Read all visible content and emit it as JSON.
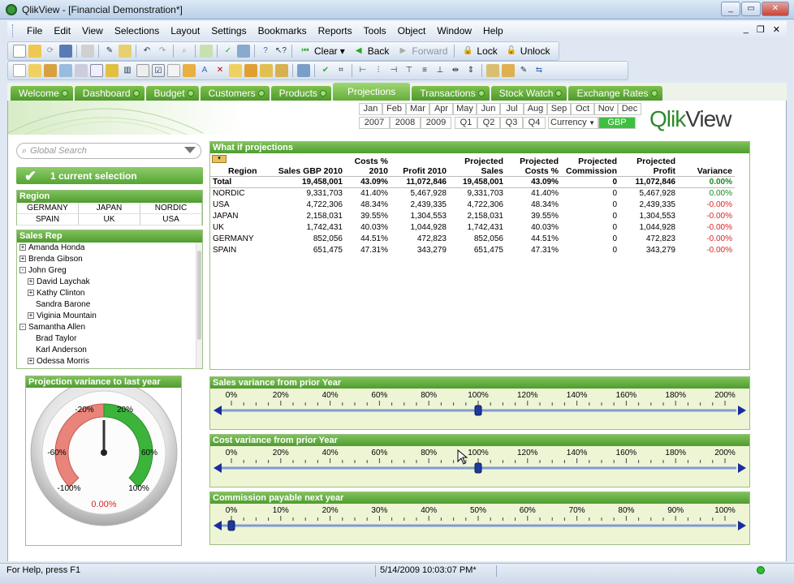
{
  "window": {
    "title": "QlikView - [Financial Demonstration*]"
  },
  "menu": [
    "File",
    "Edit",
    "View",
    "Selections",
    "Layout",
    "Settings",
    "Bookmarks",
    "Reports",
    "Tools",
    "Object",
    "Window",
    "Help"
  ],
  "toolbar": {
    "clear": "Clear",
    "back": "Back",
    "forward": "Forward",
    "lock": "Lock",
    "unlock": "Unlock"
  },
  "tabs": [
    {
      "label": "Welcome",
      "active": false
    },
    {
      "label": "Dashboard",
      "active": false
    },
    {
      "label": "Budget",
      "active": false
    },
    {
      "label": "Customers",
      "active": false
    },
    {
      "label": "Products",
      "active": false
    },
    {
      "label": "Projections",
      "active": true
    },
    {
      "label": "Transactions",
      "active": false
    },
    {
      "label": "Stock Watch",
      "active": false
    },
    {
      "label": "Exchange Rates",
      "active": false
    }
  ],
  "calendar": {
    "months": [
      "Jan",
      "Feb",
      "Mar",
      "Apr",
      "May",
      "Jun",
      "Jul",
      "Aug",
      "Sep",
      "Oct",
      "Nov",
      "Dec"
    ],
    "years": [
      "2007",
      "2008",
      "2009"
    ],
    "quarters": [
      "Q1",
      "Q2",
      "Q3",
      "Q4"
    ],
    "currency_label": "Currency",
    "currency_value": "GBP"
  },
  "logo": {
    "text": "QlikView"
  },
  "search": {
    "placeholder": "Global Search"
  },
  "current_selection": "1 current selection",
  "region": {
    "title": "Region",
    "items": [
      "GERMANY",
      "JAPAN",
      "NORDIC",
      "SPAIN",
      "UK",
      "USA"
    ]
  },
  "sales_rep": {
    "title": "Sales Rep",
    "items": [
      {
        "label": "Amanda Honda",
        "indent": 0,
        "toggle": "+"
      },
      {
        "label": "Brenda Gibson",
        "indent": 0,
        "toggle": "+"
      },
      {
        "label": "John Greg",
        "indent": 0,
        "toggle": "-"
      },
      {
        "label": "David Laychak",
        "indent": 1,
        "toggle": "+"
      },
      {
        "label": "Kathy Clinton",
        "indent": 1,
        "toggle": "+"
      },
      {
        "label": "Sandra Barone",
        "indent": 2,
        "toggle": ""
      },
      {
        "label": "Viginia Mountain",
        "indent": 1,
        "toggle": "+"
      },
      {
        "label": "Samantha Allen",
        "indent": 0,
        "toggle": "-"
      },
      {
        "label": "Brad Taylor",
        "indent": 2,
        "toggle": ""
      },
      {
        "label": "Karl Anderson",
        "indent": 2,
        "toggle": ""
      },
      {
        "label": "Odessa Morris",
        "indent": 1,
        "toggle": "+"
      }
    ]
  },
  "gauge": {
    "title": "Projection variance to last year",
    "labels": [
      "-20%",
      "20%",
      "-60%",
      "60%",
      "-100%",
      "100%"
    ],
    "value_text": "0.00%"
  },
  "projections_table": {
    "title": "What if projections",
    "headers": [
      "Region",
      "Sales GBP 2010",
      "Costs % 2010",
      "Profit 2010",
      "Projected Sales",
      "Projected Costs %",
      "Projected Commission",
      "Projected Profit",
      "Variance"
    ],
    "total": [
      "Total",
      "19,458,001",
      "43.09%",
      "11,072,846",
      "19,458,001",
      "43.09%",
      "0",
      "11,072,846",
      "0.00%"
    ],
    "rows": [
      [
        "NORDIC",
        "9,331,703",
        "41.40%",
        "5,467,928",
        "9,331,703",
        "41.40%",
        "0",
        "5,467,928",
        "0.00%"
      ],
      [
        "USA",
        "4,722,306",
        "48.34%",
        "2,439,335",
        "4,722,306",
        "48.34%",
        "0",
        "2,439,335",
        "-0.00%"
      ],
      [
        "JAPAN",
        "2,158,031",
        "39.55%",
        "1,304,553",
        "2,158,031",
        "39.55%",
        "0",
        "1,304,553",
        "-0.00%"
      ],
      [
        "UK",
        "1,742,431",
        "40.03%",
        "1,044,928",
        "1,742,431",
        "40.03%",
        "0",
        "1,044,928",
        "-0.00%"
      ],
      [
        "GERMANY",
        "852,056",
        "44.51%",
        "472,823",
        "852,056",
        "44.51%",
        "0",
        "472,823",
        "-0.00%"
      ],
      [
        "SPAIN",
        "651,475",
        "47.31%",
        "343,279",
        "651,475",
        "47.31%",
        "0",
        "343,279",
        "-0.00%"
      ]
    ]
  },
  "sliders": [
    {
      "title": "Sales variance from prior Year",
      "ticks": [
        "0%",
        "20%",
        "40%",
        "60%",
        "80%",
        "100%",
        "120%",
        "140%",
        "160%",
        "180%",
        "200%"
      ],
      "value": 1.0,
      "max": 2.0
    },
    {
      "title": "Cost variance from prior Year",
      "ticks": [
        "0%",
        "20%",
        "40%",
        "60%",
        "80%",
        "100%",
        "120%",
        "140%",
        "160%",
        "180%",
        "200%"
      ],
      "value": 1.0,
      "max": 2.0
    },
    {
      "title": "Commission payable next year",
      "ticks": [
        "0%",
        "10%",
        "20%",
        "30%",
        "40%",
        "50%",
        "60%",
        "70%",
        "80%",
        "90%",
        "100%"
      ],
      "value": 0.0,
      "max": 1.0
    }
  ],
  "status": {
    "help": "For Help, press F1",
    "timestamp": "5/14/2009 10:03:07 PM*"
  },
  "colors": {
    "accent": "#5aa83a",
    "negative": "#d22222",
    "positive": "#1a8a1a"
  }
}
